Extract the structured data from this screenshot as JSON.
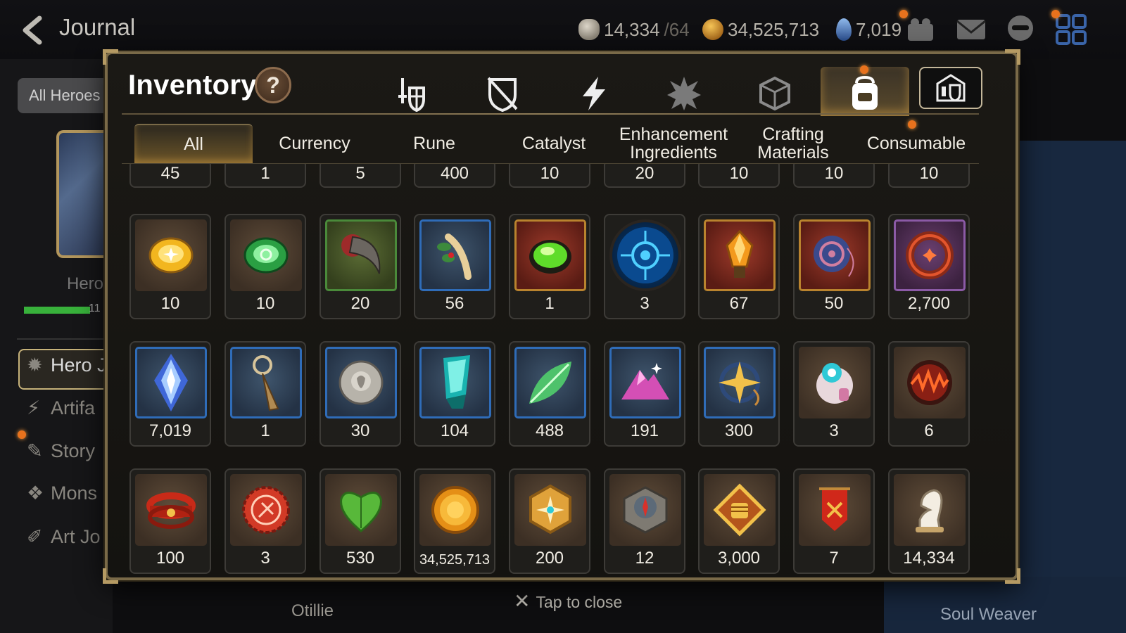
{
  "topbar": {
    "back_label": "Journal",
    "resource_1_value": "14,334",
    "resource_1_sub": "/64",
    "resource_2_value": "34,525,713",
    "resource_3_value": "7,019"
  },
  "background": {
    "filter_button": "All Heroes",
    "hero_label": "Hero",
    "hero_count": "11",
    "side_items": [
      "Hero J",
      "Artifa",
      "Story",
      "Mons",
      "Art Jo"
    ],
    "hero_name": "Otillie",
    "right_label": "Soul Weaver"
  },
  "modal": {
    "title": "Inventory",
    "help_label": "?",
    "categories": [
      "hero-equipment",
      "artifact",
      "skill",
      "unit",
      "catalyst-cube",
      "materials",
      "guild"
    ],
    "active_category": "materials",
    "tabs": [
      "All",
      "Currency",
      "Rune",
      "Catalyst",
      "Enhancement Ingredients",
      "Crafting Materials",
      "Consumable"
    ],
    "active_tab": "All",
    "close_hint": "Tap to close"
  },
  "items": {
    "row0": [
      "45",
      "1",
      "5",
      "400",
      "10",
      "20",
      "10",
      "10",
      "10"
    ],
    "row1": [
      {
        "icon": "gold-gem-icon",
        "qty": "10",
        "frame": "brown"
      },
      {
        "icon": "green-gem-icon",
        "qty": "10",
        "frame": "brown"
      },
      {
        "icon": "claw-icon",
        "qty": "20",
        "frame": "green"
      },
      {
        "icon": "herb-root-icon",
        "qty": "56",
        "frame": "blue"
      },
      {
        "icon": "green-orb-icon",
        "qty": "1",
        "frame": "red"
      },
      {
        "icon": "arcane-sphere-icon",
        "qty": "3",
        "frame": "round"
      },
      {
        "icon": "fire-crystal-icon",
        "qty": "67",
        "frame": "red"
      },
      {
        "icon": "yoyo-icon",
        "qty": "50",
        "frame": "red"
      },
      {
        "icon": "red-ring-icon",
        "qty": "2,700",
        "frame": "purple"
      }
    ],
    "row2": [
      {
        "icon": "skystone-icon",
        "qty": "7,019",
        "frame": "blue"
      },
      {
        "icon": "pendant-icon",
        "qty": "1",
        "frame": "blue"
      },
      {
        "icon": "silver-coin-icon",
        "qty": "30",
        "frame": "blue"
      },
      {
        "icon": "teal-crystal-icon",
        "qty": "104",
        "frame": "blue"
      },
      {
        "icon": "leaf-icon",
        "qty": "488",
        "frame": "blue"
      },
      {
        "icon": "pink-mountain-icon",
        "qty": "191",
        "frame": "blue"
      },
      {
        "icon": "star-amulet-icon",
        "qty": "300",
        "frame": "blue"
      },
      {
        "icon": "robot-toy-icon",
        "qty": "3",
        "frame": "brown"
      },
      {
        "icon": "red-rune-orb-icon",
        "qty": "6",
        "frame": "brown"
      }
    ],
    "row3": [
      {
        "icon": "red-bracelet-icon",
        "qty": "100",
        "frame": "brown"
      },
      {
        "icon": "red-badge-icon",
        "qty": "3",
        "frame": "brown"
      },
      {
        "icon": "green-heart-icon",
        "qty": "530",
        "frame": "brown"
      },
      {
        "icon": "gold-coin-icon",
        "qty": "34,525,713",
        "frame": "brown"
      },
      {
        "icon": "gold-hexagon-icon",
        "qty": "200",
        "frame": "brown"
      },
      {
        "icon": "stone-compass-icon",
        "qty": "12",
        "frame": "brown"
      },
      {
        "icon": "fist-emblem-icon",
        "qty": "3,000",
        "frame": "brown"
      },
      {
        "icon": "banner-icon",
        "qty": "7",
        "frame": "brown"
      },
      {
        "icon": "chess-knight-icon",
        "qty": "14,334",
        "frame": "brown"
      }
    ]
  },
  "colors": {
    "modal_border": "#7a6a48",
    "active_glow": "#ffbe50",
    "notification": "#e8721d",
    "rare_frame": "#2f6cb8"
  }
}
